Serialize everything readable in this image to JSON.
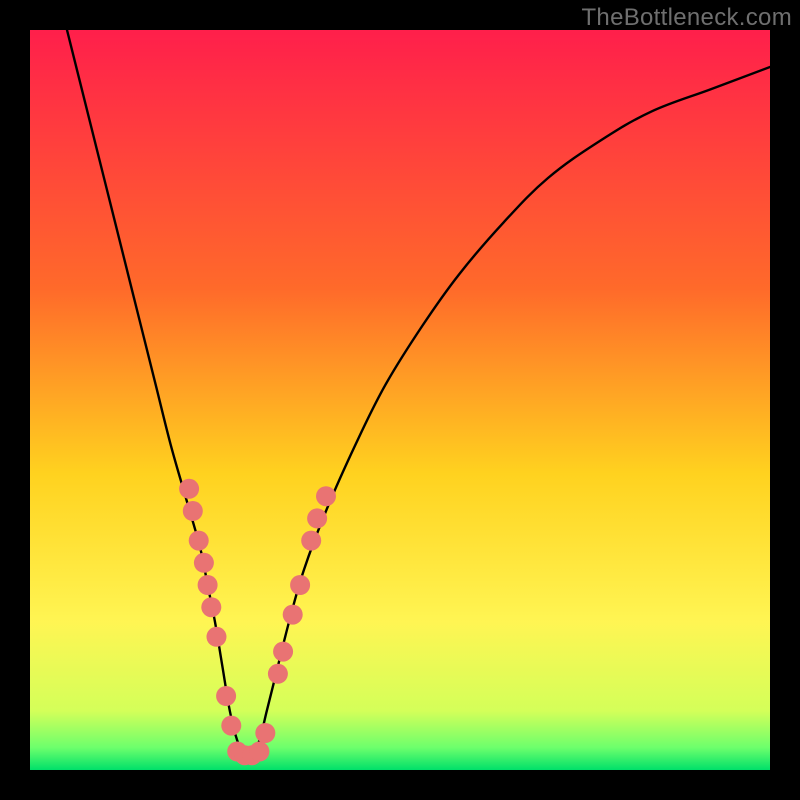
{
  "watermark": "TheBottleneck.com",
  "chart_data": {
    "type": "line",
    "title": "",
    "xlabel": "",
    "ylabel": "",
    "xlim": [
      0,
      100
    ],
    "ylim": [
      0,
      100
    ],
    "background_gradient": {
      "stops": [
        {
          "offset": 0,
          "color": "#ff1f4b"
        },
        {
          "offset": 35,
          "color": "#ff6a2a"
        },
        {
          "offset": 60,
          "color": "#ffd21f"
        },
        {
          "offset": 80,
          "color": "#fff553"
        },
        {
          "offset": 92,
          "color": "#d4ff59"
        },
        {
          "offset": 97,
          "color": "#6cff6c"
        },
        {
          "offset": 100,
          "color": "#00e06a"
        }
      ]
    },
    "series": [
      {
        "name": "bottleneck-curve",
        "color": "#000000",
        "x": [
          5,
          7,
          9,
          11,
          13,
          15,
          17,
          19,
          21,
          23,
          24,
          25,
          26,
          27,
          28,
          29,
          30,
          31,
          32,
          33,
          35,
          37,
          40,
          44,
          48,
          53,
          58,
          64,
          70,
          77,
          84,
          92,
          100
        ],
        "y": [
          100,
          92,
          84,
          76,
          68,
          60,
          52,
          44,
          37,
          30,
          25,
          20,
          14,
          8,
          4,
          2,
          2,
          4,
          8,
          12,
          20,
          27,
          35,
          44,
          52,
          60,
          67,
          74,
          80,
          85,
          89,
          92,
          95
        ]
      }
    ],
    "markers": {
      "name": "highlight-dots",
      "color": "#e97373",
      "radius": 10,
      "points": [
        {
          "x": 21.5,
          "y": 38
        },
        {
          "x": 22.0,
          "y": 35
        },
        {
          "x": 22.8,
          "y": 31
        },
        {
          "x": 23.5,
          "y": 28
        },
        {
          "x": 24.0,
          "y": 25
        },
        {
          "x": 24.5,
          "y": 22
        },
        {
          "x": 25.2,
          "y": 18
        },
        {
          "x": 26.5,
          "y": 10
        },
        {
          "x": 27.2,
          "y": 6
        },
        {
          "x": 28.0,
          "y": 2.5
        },
        {
          "x": 29.0,
          "y": 2
        },
        {
          "x": 30.0,
          "y": 2
        },
        {
          "x": 31.0,
          "y": 2.5
        },
        {
          "x": 31.8,
          "y": 5
        },
        {
          "x": 33.5,
          "y": 13
        },
        {
          "x": 34.2,
          "y": 16
        },
        {
          "x": 35.5,
          "y": 21
        },
        {
          "x": 36.5,
          "y": 25
        },
        {
          "x": 38.0,
          "y": 31
        },
        {
          "x": 38.8,
          "y": 34
        },
        {
          "x": 40.0,
          "y": 37
        }
      ]
    }
  }
}
